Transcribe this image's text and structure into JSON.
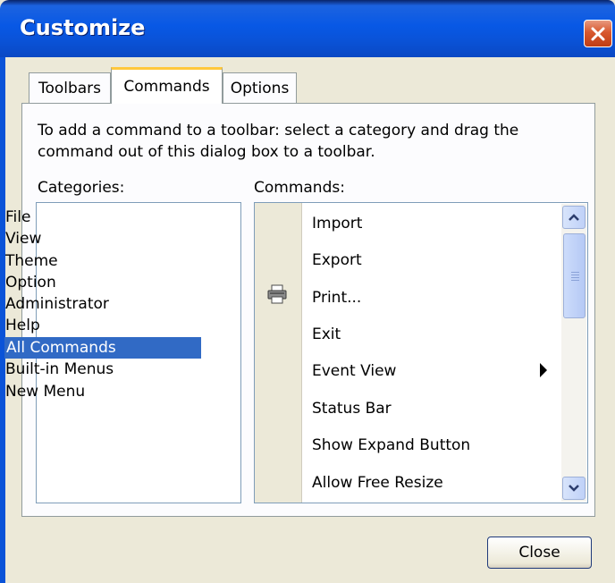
{
  "window": {
    "title": "Customize",
    "close_icon": "close-icon"
  },
  "tabs": [
    {
      "label": "Toolbars",
      "active": false
    },
    {
      "label": "Commands",
      "active": true
    },
    {
      "label": "Options",
      "active": false
    }
  ],
  "commands_tab": {
    "description": "To add a command to a toolbar: select a category and drag the command out of this dialog box to a toolbar.",
    "categories_label": "Categories:",
    "commands_label": "Commands:",
    "categories": [
      "File",
      "View",
      "Theme",
      "Option",
      "Administrator",
      "Help",
      "All Commands",
      "Built-in Menus",
      "New Menu"
    ],
    "selected_category": "All Commands",
    "commands": [
      {
        "label": "Import",
        "icon": null,
        "submenu": false
      },
      {
        "label": "Export",
        "icon": null,
        "submenu": false
      },
      {
        "label": "Print...",
        "icon": "printer-icon",
        "submenu": false
      },
      {
        "label": "Exit",
        "icon": null,
        "submenu": false
      },
      {
        "label": "Event View",
        "icon": null,
        "submenu": true
      },
      {
        "label": "Status Bar",
        "icon": null,
        "submenu": false
      },
      {
        "label": "Show Expand Button",
        "icon": null,
        "submenu": false
      },
      {
        "label": "Allow Free Resize",
        "icon": null,
        "submenu": false
      }
    ]
  },
  "footer": {
    "close_label": "Close"
  },
  "colors": {
    "titlebar": "#0a53d8",
    "selection": "#316ac5",
    "dialog_bg": "#ECE9D8",
    "close_button_red": "#d8582e",
    "active_tab_accent": "#ffc83c"
  }
}
